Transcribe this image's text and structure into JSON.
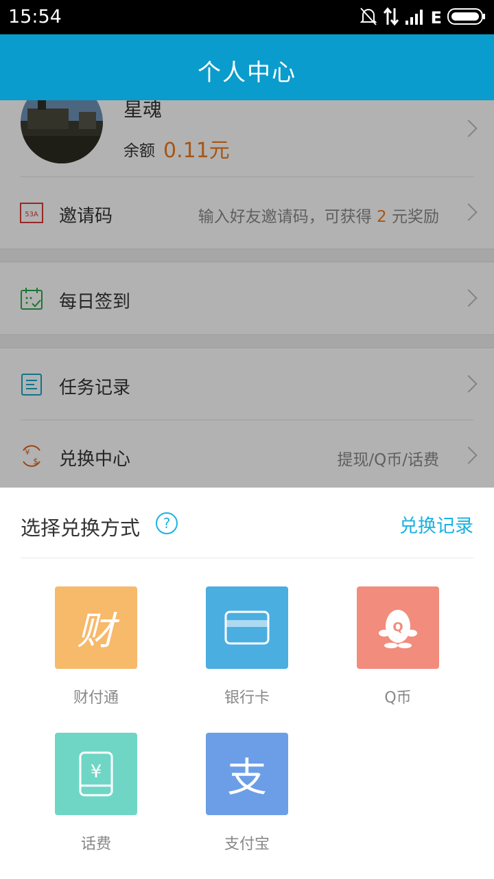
{
  "status": {
    "time": "15:54",
    "network": "E"
  },
  "header": {
    "title": "个人中心"
  },
  "profile": {
    "name": "星魂",
    "balance_label": "余额",
    "balance_value": "0.11元"
  },
  "rows": {
    "invite": {
      "label": "邀请码",
      "hint_pre": "输入好友邀请码，可获得 ",
      "hint_amount": "2",
      "hint_post": " 元奖励",
      "icon_text": "53A"
    },
    "checkin": {
      "label": "每日签到"
    },
    "tasks": {
      "label": "任务记录"
    },
    "exchange": {
      "label": "兑换中心",
      "hint": "提现/Q币/话费"
    }
  },
  "sheet": {
    "title": "选择兑换方式",
    "help": "?",
    "record_link": "兑换记录",
    "options": [
      {
        "label": "财付通",
        "glyph": "财",
        "color": "#f7b96a",
        "icon": "caifutong-icon"
      },
      {
        "label": "银行卡",
        "color": "#4aaee0",
        "icon": "bank-card-icon"
      },
      {
        "label": "Q币",
        "glyph": "Q",
        "color": "#f28c7c",
        "icon": "qq-penguin-icon"
      },
      {
        "label": "话费",
        "glyph": "¥",
        "color": "#6fd6c6",
        "icon": "phone-recharge-icon"
      },
      {
        "label": "支付宝",
        "glyph": "支",
        "color": "#6b9ee6",
        "icon": "alipay-icon"
      }
    ]
  }
}
